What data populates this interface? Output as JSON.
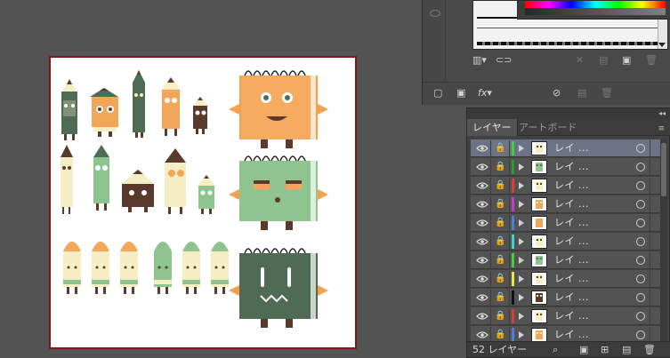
{
  "top_panel": {
    "toolbar_icons": [
      "library-icon",
      "link-chain-icon",
      "break-link-icon",
      "swatch-options-icon",
      "new-brush-icon",
      "delete-icon"
    ],
    "bottom_icons": [
      "stop-icon",
      "mask-icon",
      "fx-menu",
      "clear-icon",
      "duplicate-icon",
      "delete-icon"
    ],
    "fx_label": "fx"
  },
  "layers_panel": {
    "tabs": [
      {
        "label": "レイヤー",
        "active": true
      },
      {
        "label": "アートボード",
        "active": false
      }
    ],
    "rows": [
      {
        "name": "レイ ...",
        "color": "#3cd23c",
        "selected": true,
        "thumb": "monster-beige"
      },
      {
        "name": "レイ ...",
        "color": "#2a9e2a",
        "selected": false,
        "thumb": "monster-green"
      },
      {
        "name": "レイ ...",
        "color": "#e03a3a",
        "selected": false,
        "thumb": "monster-beige"
      },
      {
        "name": "レイ ...",
        "color": "#c838d6",
        "selected": false,
        "thumb": "monster-orange"
      },
      {
        "name": "レイ ...",
        "color": "#4a7ee0",
        "selected": false,
        "thumb": "orange-block"
      },
      {
        "name": "レイ ...",
        "color": "#3ad6d6",
        "selected": false,
        "thumb": "monster-beige"
      },
      {
        "name": "レイ ...",
        "color": "#3cd23c",
        "selected": false,
        "thumb": "monster-green"
      },
      {
        "name": "レイ ...",
        "color": "#e8e83a",
        "selected": false,
        "thumb": "monster-beige"
      },
      {
        "name": "レイ ...",
        "color": "#111111",
        "selected": false,
        "thumb": "monster-dark"
      },
      {
        "name": "レイ ...",
        "color": "#e03a3a",
        "selected": false,
        "thumb": "monster-beige"
      },
      {
        "name": "レイ ...",
        "color": "#4a7ee0",
        "selected": false,
        "thumb": "monster-orange"
      }
    ],
    "count_label": "52 レイヤー",
    "footer_icons": [
      "search-icon",
      "make-clipping-mask-icon",
      "new-sublayer-icon",
      "new-layer-icon",
      "delete-layer-icon"
    ]
  },
  "colors": {
    "app_bg": "#535353",
    "panel_bg": "#424242",
    "selected_row": "#6b7384",
    "artboard_border": "#8a1414",
    "monster_orange": "#f2a65a",
    "monster_green": "#8fc490",
    "monster_dark_green": "#4f6b55",
    "monster_beige": "#f4eec2",
    "monster_brown": "#5b3a2e"
  }
}
